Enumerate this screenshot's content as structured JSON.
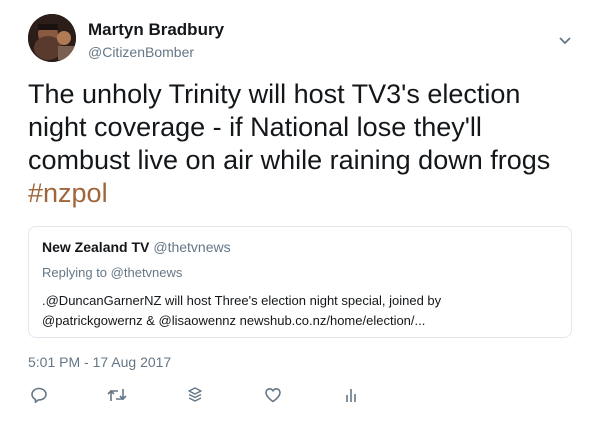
{
  "author": {
    "name": "Martyn Bradbury",
    "handle": "@CitizenBomber"
  },
  "tweet": {
    "text": "The unholy Trinity will host TV3's election\nnight coverage - if National lose they'll\ncombust live on air while raining down frogs\n",
    "hashtag": "#nzpol"
  },
  "quoted": {
    "name": "New Zealand TV",
    "handle": "@thetvnews",
    "reply_prefix": "Replying to",
    "reply_handle": "@thetvnews",
    "text": ".@DuncanGarnerNZ will host Three's election night special, joined by\n@patrickgowernz & @lisaowennz newshub.co.nz/home/election/..."
  },
  "timestamp": "5:01 PM - 17 Aug 2017",
  "colors": {
    "hashtag": "#a0663b",
    "secondary_text": "#657786",
    "icon": "#657786",
    "border": "#e1e8ed"
  },
  "icons": {
    "menu": "chevron-down-icon",
    "reply": "reply-icon",
    "retweet": "retweet-icon",
    "stack": "layers-icon",
    "like": "heart-icon",
    "analytics": "analytics-icon"
  }
}
